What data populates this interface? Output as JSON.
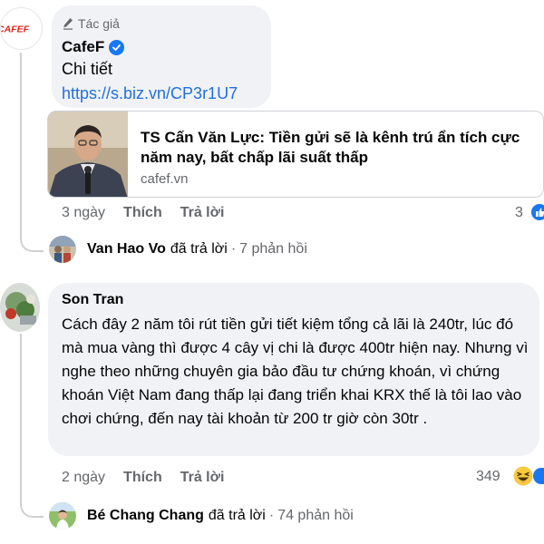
{
  "cafef_comment": {
    "author_tag": "Tác giả",
    "author_name": "CafeF",
    "text_line": "Chi tiết",
    "link": "https://s.biz.vn/CP3r1U7",
    "avatar_logo": "CAFEF",
    "preview": {
      "title": "TS Cấn Văn Lực: Tiền gửi sẽ là kênh trú ẩn tích cực năm nay, bất chấp lãi suất thấp",
      "domain": "cafef.vn"
    },
    "actions": {
      "time": "3 ngày",
      "like": "Thích",
      "reply": "Trả lời"
    },
    "reaction_count": "3",
    "reply_summary": {
      "name": "Van Hao Vo",
      "text": "đã trả lời",
      "separator": "·",
      "count": "7 phản hồi"
    }
  },
  "son_comment": {
    "author_name": "Son Tran",
    "body": "Cách đây 2 năm tôi rút tiền gửi tiết kiệm tổng cả lãi là 240tr, lúc đó mà mua vàng thì được 4 cây vị chi là được 400tr hiện nay. Nhưng vì nghe theo những chuyên gia bảo đầu tư chứng khoán, vì chứng khoán Việt Nam đang thấp lại đang triển khai KRX thế là tôi lao vào chơi chứng, đến nay tài khoản từ 200 tr giờ còn 30tr .",
    "actions": {
      "time": "2 ngày",
      "like": "Thích",
      "reply": "Trả lời"
    },
    "reaction_count": "349",
    "reply_summary": {
      "name": "Bé Chang Chang",
      "text": "đã trả lời",
      "separator": "·",
      "count": "74 phản hồi"
    }
  },
  "colors": {
    "bubble_bg": "#f0f2f5",
    "link": "#216fdb",
    "secondary_text": "#65676b",
    "like_blue": "#1877f2",
    "cafef_red": "#e0261b"
  },
  "icons": {
    "author_tag": "pen-icon",
    "verified": "verified-badge-icon",
    "like_reaction": "like-reaction-icon",
    "haha_reaction": "haha-reaction-icon"
  }
}
